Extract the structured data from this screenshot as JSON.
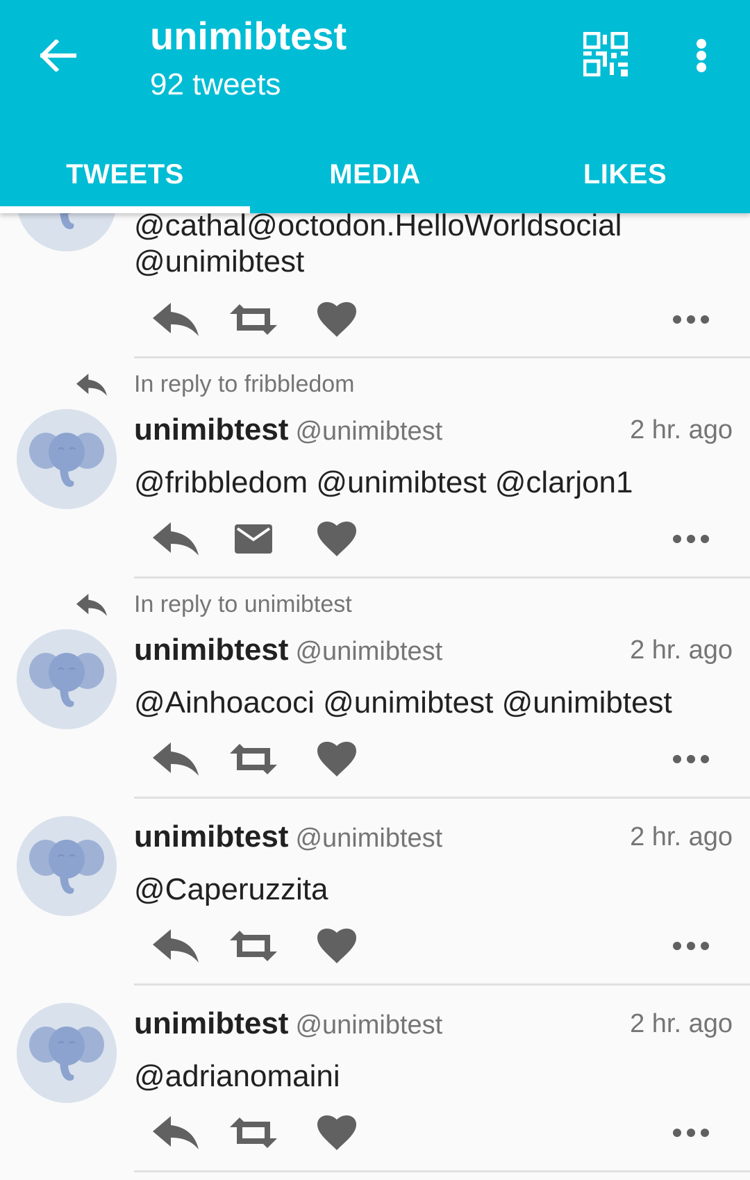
{
  "appbar": {
    "title": "unimibtest",
    "subtitle": "92 tweets",
    "back_icon": "arrow-back-icon",
    "qr_icon": "qr-code-icon",
    "overflow_icon": "more-vert-icon",
    "background": "#00bcd4"
  },
  "tabs": [
    {
      "label": "TWEETS",
      "selected": true
    },
    {
      "label": "MEDIA",
      "selected": false
    },
    {
      "label": "LIKES",
      "selected": false
    }
  ],
  "statuses": [
    {
      "content_lines": [
        "@cathal@octodon.HelloWorldsocial",
        "@unimibtest"
      ],
      "second_action": "boost-icon"
    },
    {
      "reply_to": "In reply to fribbledom",
      "display_name": "unimibtest",
      "username": "@unimibtest",
      "timestamp": "2 hr. ago",
      "content": "@fribbledom @unimibtest @clarjon1",
      "second_action": "direct-message-icon"
    },
    {
      "reply_to": "In reply to unimibtest",
      "display_name": "unimibtest",
      "username": "@unimibtest",
      "timestamp": "2 hr. ago",
      "content": "@Ainhoacoci @unimibtest @unimibtest",
      "second_action": "boost-icon"
    },
    {
      "display_name": "unimibtest",
      "username": "@unimibtest",
      "timestamp": "2 hr. ago",
      "content": "@Caperuzzita",
      "second_action": "boost-icon"
    },
    {
      "display_name": "unimibtest",
      "username": "@unimibtest",
      "timestamp": "2 hr. ago",
      "content": "@adrianomaini",
      "second_action": "boost-icon"
    }
  ]
}
